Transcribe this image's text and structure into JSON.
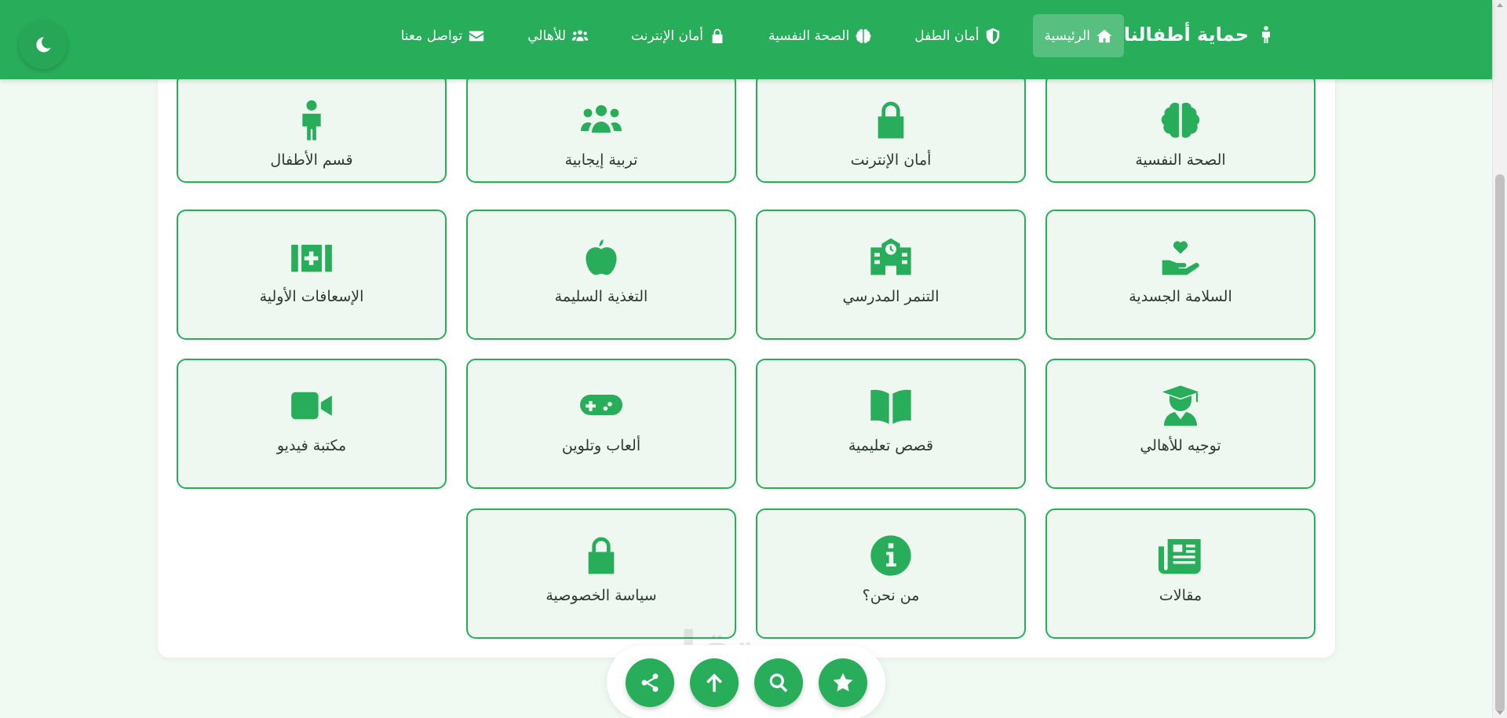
{
  "brand": {
    "title": "حماية أطفالنا",
    "icon": "child-icon"
  },
  "nav": {
    "items": [
      {
        "label": "الرئيسية",
        "icon": "home-icon",
        "active": true
      },
      {
        "label": "أمان الطفل",
        "icon": "shield-icon",
        "active": false
      },
      {
        "label": "الصحة النفسية",
        "icon": "brain-icon",
        "active": false
      },
      {
        "label": "أمان الإنترنت",
        "icon": "lock-icon",
        "active": false
      },
      {
        "label": "للأهالي",
        "icon": "users-icon",
        "active": false
      },
      {
        "label": "تواصل معنا",
        "icon": "envelope-icon",
        "active": false
      }
    ]
  },
  "theme_toggle": {
    "icon": "moon-icon"
  },
  "cards": [
    {
      "label": "الصحة النفسية",
      "icon": "brain-icon"
    },
    {
      "label": "أمان الإنترنت",
      "icon": "lock-icon"
    },
    {
      "label": "تربية إيجابية",
      "icon": "users-icon"
    },
    {
      "label": "قسم الأطفال",
      "icon": "child-icon"
    },
    {
      "label": "السلامة الجسدية",
      "icon": "hand-heart-icon"
    },
    {
      "label": "التنمر المدرسي",
      "icon": "school-icon"
    },
    {
      "label": "التغذية السليمة",
      "icon": "apple-icon"
    },
    {
      "label": "الإسعافات الأولية",
      "icon": "first-aid-icon"
    },
    {
      "label": "توجيه للأهالي",
      "icon": "graduate-icon"
    },
    {
      "label": "قصص تعليمية",
      "icon": "book-icon"
    },
    {
      "label": "ألعاب وتلوين",
      "icon": "gamepad-icon"
    },
    {
      "label": "مكتبة فيديو",
      "icon": "video-icon"
    },
    {
      "label": "مقالات",
      "icon": "newspaper-icon"
    },
    {
      "label": "من نحن؟",
      "icon": "info-icon"
    },
    {
      "label": "سياسة الخصوصية",
      "icon": "lock-icon"
    }
  ],
  "fab_buttons": [
    {
      "name": "share-button",
      "icon": "share-icon"
    },
    {
      "name": "scroll-top-button",
      "icon": "arrow-up-icon"
    },
    {
      "name": "search-button",
      "icon": "search-icon"
    },
    {
      "name": "favorite-button",
      "icon": "star-icon"
    }
  ],
  "watermark": {
    "text_ar": "مستقل",
    "text_en": "mostaql.com"
  },
  "colors": {
    "primary": "#28ad5b",
    "card_bg": "#eef8f0",
    "page_bg": "#f1f9f3"
  }
}
